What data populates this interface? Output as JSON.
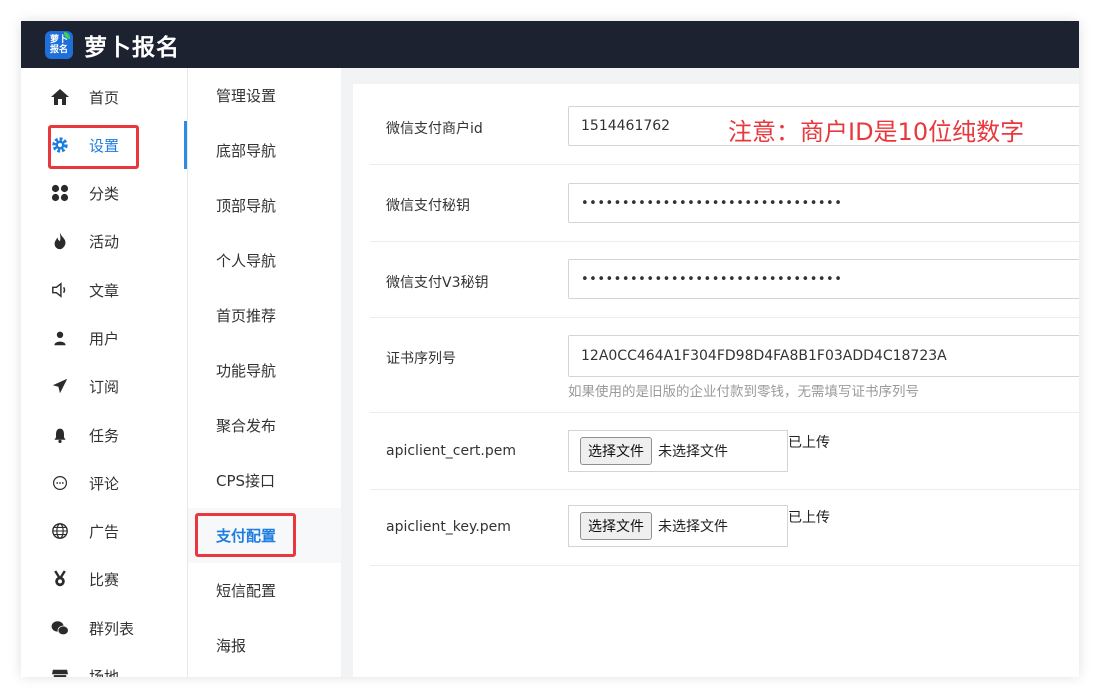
{
  "app": {
    "logo_top": "萝卜",
    "logo_bottom": "报名",
    "title": "萝卜报名"
  },
  "sidebar": {
    "items": [
      {
        "label": "首页",
        "icon": "home-icon"
      },
      {
        "label": "设置",
        "icon": "gear-icon"
      },
      {
        "label": "分类",
        "icon": "category-icon"
      },
      {
        "label": "活动",
        "icon": "fire-icon"
      },
      {
        "label": "文章",
        "icon": "speaker-icon"
      },
      {
        "label": "用户",
        "icon": "user-icon"
      },
      {
        "label": "订阅",
        "icon": "send-icon"
      },
      {
        "label": "任务",
        "icon": "bell-icon"
      },
      {
        "label": "评论",
        "icon": "comment-icon"
      },
      {
        "label": "广告",
        "icon": "globe-icon"
      },
      {
        "label": "比赛",
        "icon": "medal-icon"
      },
      {
        "label": "群列表",
        "icon": "wechat-icon"
      },
      {
        "label": "场地",
        "icon": "store-icon"
      }
    ]
  },
  "subnav": {
    "items": [
      "管理设置",
      "底部导航",
      "顶部导航",
      "个人导航",
      "首页推荐",
      "功能导航",
      "聚合发布",
      "CPS接口",
      "支付配置",
      "短信配置",
      "海报"
    ]
  },
  "form": {
    "merchant_id": {
      "label": "微信支付商户id",
      "value": "1514461762",
      "note": "注意：商户ID是10位纯数字"
    },
    "secret": {
      "label": "微信支付秘钥",
      "value": "••••••••••••••••••••••••••••••••"
    },
    "v3_secret": {
      "label": "微信支付V3秘钥",
      "value": "••••••••••••••••••••••••••••••••"
    },
    "serial": {
      "label": "证书序列号",
      "value": "12A0CC464A1F304FD98D4FA8B1F03ADD4C18723A",
      "hint": "如果使用的是旧版的企业付款到零钱，无需填写证书序列号"
    },
    "cert": {
      "label": "apiclient_cert.pem",
      "button": "选择文件",
      "filename": "未选择文件",
      "status": "已上传"
    },
    "key": {
      "label": "apiclient_key.pem",
      "button": "选择文件",
      "filename": "未选择文件",
      "status": "已上传"
    }
  },
  "colors": {
    "topbar": "#1c2230",
    "accent": "#1e7ee0",
    "annotation": "#e8383d"
  }
}
